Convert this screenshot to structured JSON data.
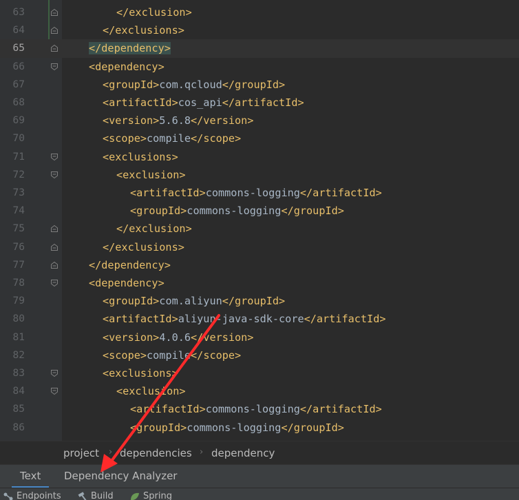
{
  "editor": {
    "current_line": "65",
    "lines": [
      {
        "n": "63",
        "indent": 8,
        "fold": "end",
        "seg": [
          {
            "c": "tag",
            "t": "</exclusion>"
          }
        ]
      },
      {
        "n": "64",
        "indent": 6,
        "fold": "end",
        "seg": [
          {
            "c": "tag",
            "t": "</exclusions>"
          }
        ]
      },
      {
        "n": "65",
        "indent": 4,
        "fold": "end",
        "current": true,
        "seg": [
          {
            "c": "tag hl",
            "t": "</dependency>"
          }
        ]
      },
      {
        "n": "66",
        "indent": 4,
        "fold": "start",
        "seg": [
          {
            "c": "tag",
            "t": "<dependency>"
          }
        ]
      },
      {
        "n": "67",
        "indent": 6,
        "fold": "",
        "seg": [
          {
            "c": "tag",
            "t": "<groupId>"
          },
          {
            "c": "txt",
            "t": "com.qcloud"
          },
          {
            "c": "tag",
            "t": "</groupId>"
          }
        ]
      },
      {
        "n": "68",
        "indent": 6,
        "fold": "",
        "seg": [
          {
            "c": "tag",
            "t": "<artifactId>"
          },
          {
            "c": "txt",
            "t": "cos_api"
          },
          {
            "c": "tag",
            "t": "</artifactId>"
          }
        ]
      },
      {
        "n": "69",
        "indent": 6,
        "fold": "",
        "seg": [
          {
            "c": "tag",
            "t": "<version>"
          },
          {
            "c": "txt",
            "t": "5.6.8"
          },
          {
            "c": "tag",
            "t": "</version>"
          }
        ]
      },
      {
        "n": "70",
        "indent": 6,
        "fold": "",
        "seg": [
          {
            "c": "tag",
            "t": "<scope>"
          },
          {
            "c": "txt",
            "t": "compile"
          },
          {
            "c": "tag",
            "t": "</scope>"
          }
        ]
      },
      {
        "n": "71",
        "indent": 6,
        "fold": "start",
        "seg": [
          {
            "c": "tag",
            "t": "<exclusions>"
          }
        ]
      },
      {
        "n": "72",
        "indent": 8,
        "fold": "start",
        "seg": [
          {
            "c": "tag",
            "t": "<exclusion>"
          }
        ]
      },
      {
        "n": "73",
        "indent": 10,
        "fold": "",
        "seg": [
          {
            "c": "tag",
            "t": "<artifactId>"
          },
          {
            "c": "txt",
            "t": "commons-logging"
          },
          {
            "c": "tag",
            "t": "</artifactId>"
          }
        ]
      },
      {
        "n": "74",
        "indent": 10,
        "fold": "",
        "seg": [
          {
            "c": "tag",
            "t": "<groupId>"
          },
          {
            "c": "txt",
            "t": "commons-logging"
          },
          {
            "c": "tag",
            "t": "</groupId>"
          }
        ]
      },
      {
        "n": "75",
        "indent": 8,
        "fold": "end",
        "seg": [
          {
            "c": "tag",
            "t": "</exclusion>"
          }
        ]
      },
      {
        "n": "76",
        "indent": 6,
        "fold": "end",
        "seg": [
          {
            "c": "tag",
            "t": "</exclusions>"
          }
        ]
      },
      {
        "n": "77",
        "indent": 4,
        "fold": "end",
        "seg": [
          {
            "c": "tag",
            "t": "</dependency>"
          }
        ]
      },
      {
        "n": "78",
        "indent": 4,
        "fold": "start",
        "seg": [
          {
            "c": "tag",
            "t": "<dependency>"
          }
        ]
      },
      {
        "n": "79",
        "indent": 6,
        "fold": "",
        "seg": [
          {
            "c": "tag",
            "t": "<groupId>"
          },
          {
            "c": "txt",
            "t": "com.aliyun"
          },
          {
            "c": "tag",
            "t": "</groupId>"
          }
        ]
      },
      {
        "n": "80",
        "indent": 6,
        "fold": "",
        "seg": [
          {
            "c": "tag",
            "t": "<artifactId>"
          },
          {
            "c": "txt",
            "t": "aliyun-java-sdk-core"
          },
          {
            "c": "tag",
            "t": "</artifactId>"
          }
        ]
      },
      {
        "n": "81",
        "indent": 6,
        "fold": "",
        "seg": [
          {
            "c": "tag",
            "t": "<version>"
          },
          {
            "c": "txt",
            "t": "4.0.6"
          },
          {
            "c": "tag",
            "t": "</version>"
          }
        ]
      },
      {
        "n": "82",
        "indent": 6,
        "fold": "",
        "seg": [
          {
            "c": "tag",
            "t": "<scope>"
          },
          {
            "c": "txt",
            "t": "compile"
          },
          {
            "c": "tag",
            "t": "</scope>"
          }
        ]
      },
      {
        "n": "83",
        "indent": 6,
        "fold": "start",
        "seg": [
          {
            "c": "tag",
            "t": "<exclusions>"
          }
        ]
      },
      {
        "n": "84",
        "indent": 8,
        "fold": "start",
        "seg": [
          {
            "c": "tag",
            "t": "<exclusion>"
          }
        ]
      },
      {
        "n": "85",
        "indent": 10,
        "fold": "",
        "seg": [
          {
            "c": "tag",
            "t": "<artifactId>"
          },
          {
            "c": "txt",
            "t": "commons-logging"
          },
          {
            "c": "tag",
            "t": "</artifactId>"
          }
        ]
      },
      {
        "n": "86",
        "indent": 10,
        "fold": "",
        "seg": [
          {
            "c": "tag",
            "t": "<groupId>"
          },
          {
            "c": "txt",
            "t": "commons-logging"
          },
          {
            "c": "tag",
            "t": "</groupId>"
          }
        ]
      }
    ]
  },
  "breadcrumb": {
    "items": [
      "project",
      "dependencies",
      "dependency"
    ],
    "separator": "›"
  },
  "tabs": {
    "text_label": "Text",
    "analyzer_label": "Dependency Analyzer",
    "active": "Text"
  },
  "toolstrip": {
    "endpoints_label": "Endpoints",
    "build_label": "Build",
    "spring_label": "Spring"
  },
  "annotation": {
    "arrow_color": "#ff2a2a",
    "arrow_icon": "red-arrow-pointing-to-dependency-analyzer-tab"
  },
  "colors": {
    "background": "#2b2b2b",
    "tag": "#e8bf6a",
    "text": "#a9b7c6",
    "tab_underline": "#4a88c7"
  }
}
